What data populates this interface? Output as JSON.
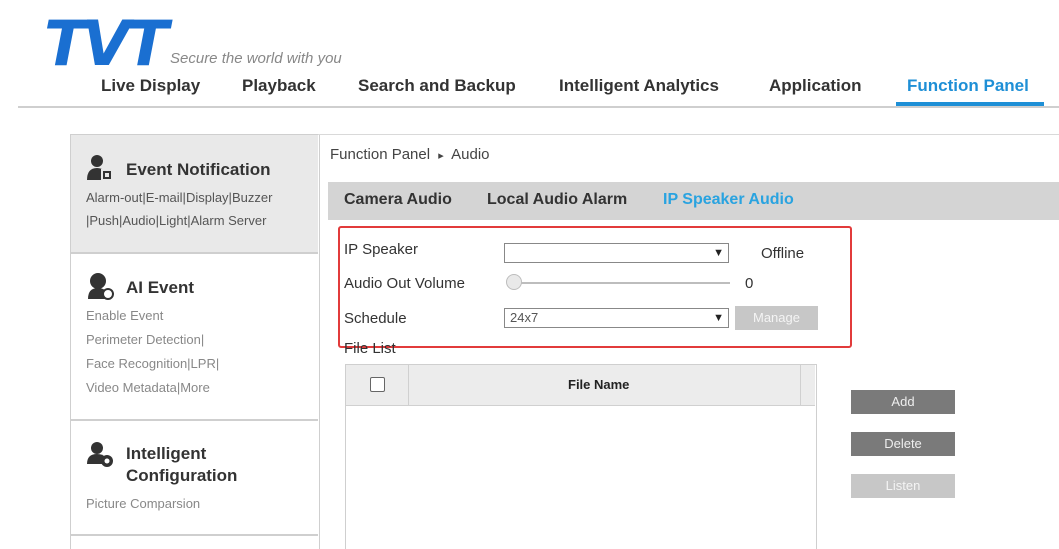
{
  "brand": {
    "logo": "TVT",
    "tagline": "Secure the world with you",
    "accent": "#1e8fd6",
    "logo_color": "#1a6fd1"
  },
  "nav": {
    "items": [
      "Live Display",
      "Playback",
      "Search and Backup",
      "Intelligent Analytics",
      "Application",
      "Function Panel"
    ],
    "active": "Function Panel"
  },
  "sidebar": {
    "sections": [
      {
        "icon": "person-alert-icon",
        "title": "Event Notification",
        "links": [
          "Alarm-out|E-mail|Display|Buzzer",
          "|Push|Audio|Light|Alarm Server"
        ]
      },
      {
        "icon": "ai-person-icon",
        "title": "AI Event",
        "links": [
          "Enable Event",
          "Perimeter Detection|",
          "Face Recognition|LPR|",
          "Video Metadata|More"
        ]
      },
      {
        "icon": "gear-person-icon",
        "title_line1": "Intelligent",
        "title_line2": "Configuration",
        "links": [
          "Picture Comparsion"
        ]
      }
    ]
  },
  "breadcrumb": {
    "root": "Function Panel",
    "separator": "▸",
    "current": "Audio"
  },
  "tabs": {
    "items": [
      "Camera Audio",
      "Local Audio Alarm",
      "IP Speaker Audio"
    ],
    "active": "IP Speaker Audio",
    "active_color": "#29a3e0"
  },
  "form": {
    "ip_speaker": {
      "label": "IP Speaker",
      "value": "",
      "status": "Offline"
    },
    "volume": {
      "label": "Audio Out Volume",
      "value": "0",
      "level": 0
    },
    "schedule": {
      "label": "Schedule",
      "value": "24x7",
      "manage_label": "Manage"
    },
    "highlight_color": "#e23b3b"
  },
  "file_list": {
    "label": "File List",
    "columns": [
      "File Name"
    ],
    "rows": [],
    "buttons": {
      "add": "Add",
      "delete": "Delete",
      "listen": "Listen"
    }
  }
}
